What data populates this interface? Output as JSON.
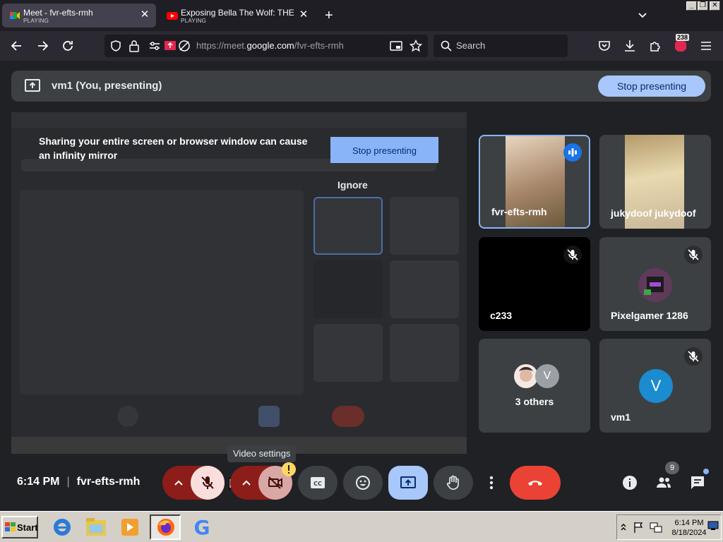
{
  "browser": {
    "tabs": [
      {
        "title": "Meet - fvr-efts-rmh",
        "subtitle": "PLAYING",
        "active": true
      },
      {
        "title": "Exposing Bella The Wolf: THE FINAL",
        "subtitle": "PLAYING",
        "active": false
      }
    ],
    "url_prefix": "https://meet.",
    "url_domain": "google.com",
    "url_path": "/fvr-efts-rmh",
    "search_placeholder": "Search",
    "extension_badge": "238"
  },
  "meet": {
    "presenting_label": "vm1 (You, presenting)",
    "stop_presenting": "Stop presenting",
    "warning_text": "Sharing your entire screen or browser window can cause an infinity mirror",
    "preview_stop_presenting": "Stop presenting",
    "ignore_label": "Ignore",
    "participants": [
      {
        "name": "fvr-efts-rmh",
        "speaking": true
      },
      {
        "name": "jukydoof jukydoof",
        "muted": false
      },
      {
        "name": "c233",
        "muted": true
      },
      {
        "name": "Pixelgamer 1286",
        "muted": true
      },
      {
        "name": "3 others",
        "avatar_letter": "V"
      },
      {
        "name": "vm1",
        "muted": true,
        "avatar_letter": "V"
      }
    ],
    "time": "6:14 PM",
    "meeting_code": "fvr-efts-rmh",
    "video_tooltip": "Video settings",
    "people_count": "9",
    "colors": {
      "accent": "#a8c7fa",
      "end_call": "#ea4335",
      "muted_bg": "#f9dedc",
      "dark_red": "#8c1d18"
    }
  },
  "taskbar": {
    "start_label": "Start",
    "clock_time": "6:14 PM",
    "clock_date": "8/18/2024"
  }
}
